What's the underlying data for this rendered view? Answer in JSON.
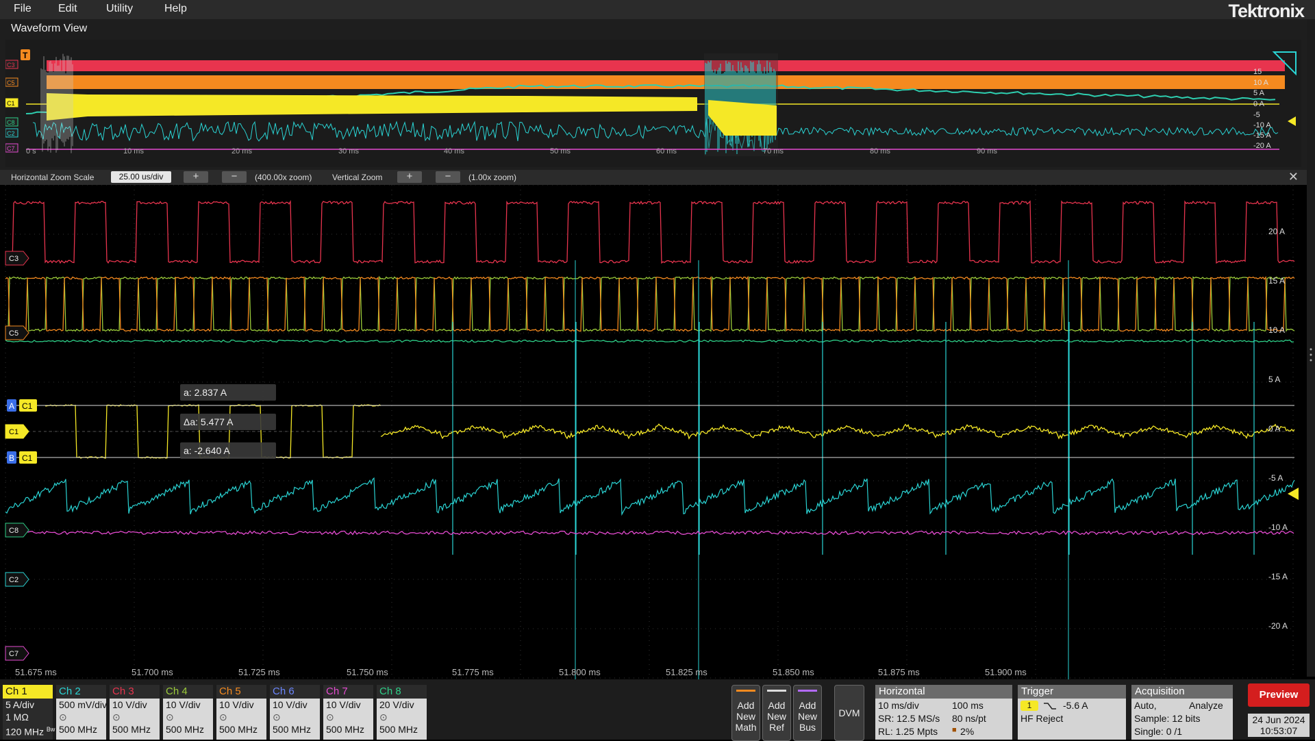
{
  "menu": {
    "items": [
      "File",
      "Edit",
      "Utility",
      "Help"
    ],
    "brand": "Tektronix"
  },
  "waveform_view": {
    "title": "Waveform View",
    "time_ticks": [
      "0 s",
      "10 ms",
      "20 ms",
      "30 ms",
      "40 ms",
      "50 ms",
      "60 ms",
      "70 ms",
      "80 ms",
      "90 ms"
    ],
    "amp_ticks": [
      "15",
      "10 A",
      "5 A",
      "0 A",
      "-5",
      "-10 A",
      "-15 A",
      "-20 A"
    ],
    "channel_tags": [
      "C3",
      "C5",
      "C1",
      "C8",
      "C2",
      "C7"
    ],
    "trigger_marker": "T"
  },
  "zoom": {
    "horizontal_label": "Horizontal Zoom Scale",
    "horizontal_value": "25.00 us/div",
    "horizontal_factor": "(400.00x zoom)",
    "vertical_label": "Vertical Zoom",
    "vertical_factor": "(1.00x zoom)",
    "plus": "+",
    "minus": "−",
    "close": "✕"
  },
  "main_plot": {
    "time_ticks": [
      "51.675 ms",
      "51.700 ms",
      "51.725 ms",
      "51.750 ms",
      "51.775 ms",
      "51.800 ms",
      "51.825 ms",
      "51.850 ms",
      "51.875 ms",
      "51.900 ms"
    ],
    "amp_ticks": [
      "20 A",
      "15 A",
      "10 A",
      "5 A",
      "0 A",
      "-5 A",
      "-10 A",
      "-15 A",
      "-20 A"
    ],
    "channel_tags": [
      "C3",
      "C5",
      "C1",
      "C8",
      "C2",
      "C7"
    ],
    "cursor_a_tag": "A",
    "cursor_b_tag": "B",
    "cursor_channel": "C1",
    "cursor_a_readout": "a: 2.837 A",
    "cursor_delta_readout": "Δa: 5.477 A",
    "cursor_b_readout": "a: -2.640 A"
  },
  "channels": [
    {
      "name": "Ch 1",
      "line1": "5 A/div",
      "line2": "1 MΩ",
      "line3": "120 MHz",
      "bw_tag": "Bw",
      "color": "#f5e826"
    },
    {
      "name": "Ch 2",
      "line1": "500 mV/div",
      "line2": "",
      "line3": "500 MHz",
      "color": "#2ad4d4"
    },
    {
      "name": "Ch 3",
      "line1": "10 V/div",
      "line2": "",
      "line3": "500 MHz",
      "color": "#e8344e"
    },
    {
      "name": "Ch 4",
      "line1": "10 V/div",
      "line2": "",
      "line3": "500 MHz",
      "color": "#9ccc3a"
    },
    {
      "name": "Ch 5",
      "line1": "10 V/div",
      "line2": "",
      "line3": "500 MHz",
      "color": "#f58a1f"
    },
    {
      "name": "Ch 6",
      "line1": "10 V/div",
      "line2": "",
      "line3": "500 MHz",
      "color": "#6b86ff"
    },
    {
      "name": "Ch 7",
      "line1": "10 V/div",
      "line2": "",
      "line3": "500 MHz",
      "color": "#e54bd1"
    },
    {
      "name": "Ch 8",
      "line1": "20 V/div",
      "line2": "",
      "line3": "500 MHz",
      "color": "#2ecf88"
    }
  ],
  "add_buttons": [
    {
      "l1": "Add",
      "l2": "New",
      "l3": "Math",
      "accent": "#f58a1f"
    },
    {
      "l1": "Add",
      "l2": "New",
      "l3": "Ref",
      "accent": "#dddddd"
    },
    {
      "l1": "Add",
      "l2": "New",
      "l3": "Bus",
      "accent": "#b36bff"
    }
  ],
  "dvm": "DVM",
  "horizontal": {
    "title": "Horizontal",
    "scale": "10 ms/div",
    "position": "100 ms",
    "sample_rate": "SR: 12.5 MS/s",
    "resolution": "80 ns/pt",
    "record_length": "RL: 1.25 Mpts",
    "percent": "2%"
  },
  "trigger": {
    "title": "Trigger",
    "source": "1",
    "level": "-5.6 A",
    "mode": "HF Reject"
  },
  "acquisition": {
    "title": "Acquisition",
    "mode": "Auto,",
    "analyze": "Analyze",
    "sample": "Sample: 12 bits",
    "single": "Single: 0 /1"
  },
  "preview": "Preview",
  "date": "24 Jun 2024",
  "time": "10:53:07"
}
